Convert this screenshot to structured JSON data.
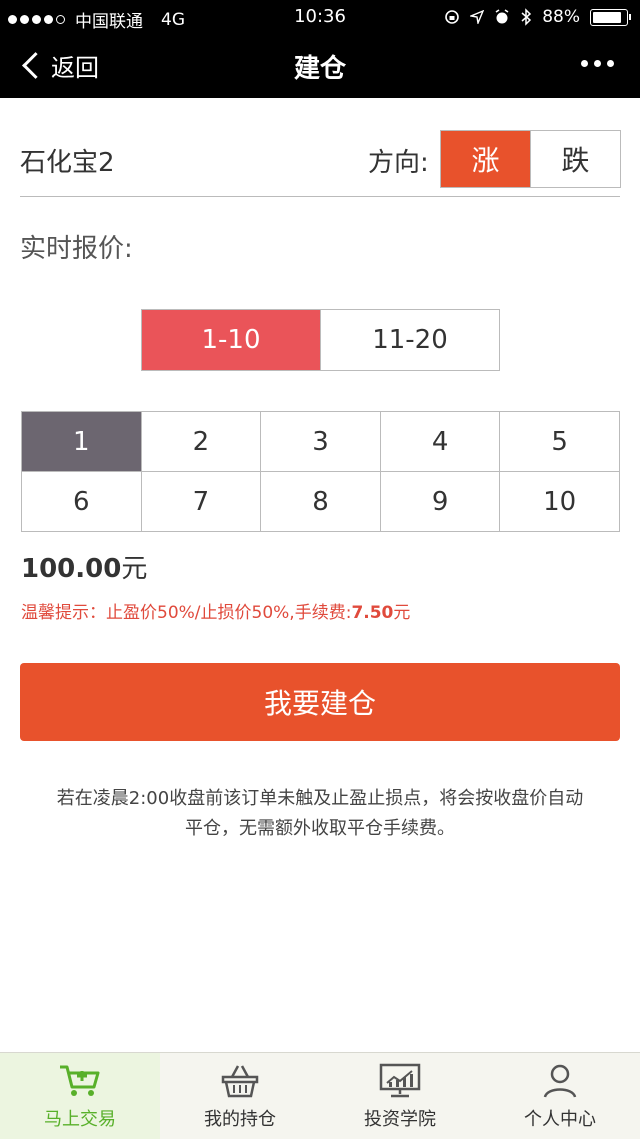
{
  "status_bar": {
    "carrier": "中国联通",
    "network": "4G",
    "time": "10:36",
    "battery": "88%"
  },
  "nav": {
    "back_label": "返回",
    "title": "建仓"
  },
  "product": {
    "name": "石化宝2",
    "direction_label": "方向:",
    "direction_up": "涨",
    "direction_down": "跌",
    "selected_direction": "涨"
  },
  "quote_label": "实时报价:",
  "range_tabs": [
    "1-10",
    "11-20"
  ],
  "selected_range": "1-10",
  "quantities": [
    "1",
    "2",
    "3",
    "4",
    "5",
    "6",
    "7",
    "8",
    "9",
    "10"
  ],
  "selected_quantity": "1",
  "amount": {
    "value": "100.00",
    "unit": "元"
  },
  "tip": {
    "prefix": "温馨提示：止盈价50%/止损价50%,手续费:",
    "fee": "7.50",
    "unit": "元"
  },
  "build_button": "我要建仓",
  "note": {
    "line1": "若在凌晨2:00收盘前该订单未触及止盈止损点，将会按收盘价自动",
    "line2": "平仓，无需额外收取平仓手续费。"
  },
  "tabbar": [
    {
      "label": "马上交易",
      "icon": "cart-icon",
      "active": true
    },
    {
      "label": "我的持仓",
      "icon": "basket-icon",
      "active": false
    },
    {
      "label": "投资学院",
      "icon": "monitor-chart-icon",
      "active": false
    },
    {
      "label": "个人中心",
      "icon": "person-icon",
      "active": false
    }
  ],
  "colors": {
    "accent": "#e8522c",
    "range_active": "#ea5459",
    "quantity_active": "#6c6670",
    "tab_active": "#58b02a"
  }
}
